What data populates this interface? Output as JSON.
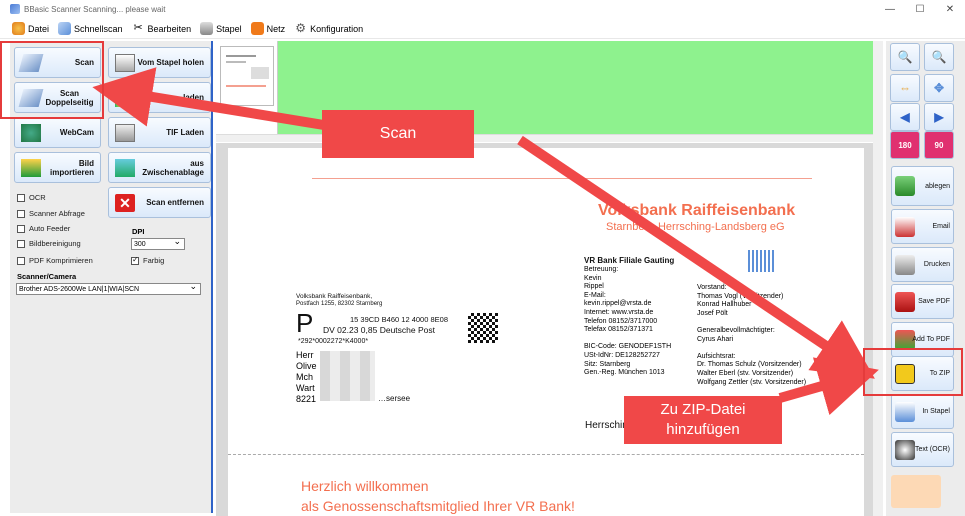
{
  "window": {
    "title": "BBasic Scanner Scanning... please wait",
    "controls": [
      "—",
      "☐",
      "✕"
    ]
  },
  "menu": [
    {
      "label": "Datei",
      "icon": "datei-icon",
      "color": "#e8a02b"
    },
    {
      "label": "Schnellscan",
      "icon": "schnellscan-icon",
      "color": "#5b8fd8"
    },
    {
      "label": "Bearbeiten",
      "icon": "scissors-icon",
      "color": "#888888"
    },
    {
      "label": "Stapel",
      "icon": "stapel-icon",
      "color": "#7a7a7a"
    },
    {
      "label": "Netz",
      "icon": "rss-icon",
      "color": "#f07a1a"
    },
    {
      "label": "Konfiguration",
      "icon": "gear-icon",
      "color": "#555555"
    }
  ],
  "left": {
    "scan": "Scan",
    "scan_duplex": "Scan Doppelseitig",
    "stapel_holen": "Vom Stapel holen",
    "hidden_btn": "…laden",
    "webcam": "WebCam",
    "tif_laden": "TIF Laden",
    "bild_importieren": "Bild importieren",
    "zwischenablage": "aus Zwischenablage",
    "scan_entfernen": "Scan entfernen",
    "options": [
      {
        "label": "OCR",
        "checked": false
      },
      {
        "label": "Scanner Abfrage",
        "checked": false
      },
      {
        "label": "Auto Feeder",
        "checked": false
      },
      {
        "label": "Bildbereinigung",
        "checked": false
      },
      {
        "label": "PDF Komprimieren",
        "checked": false
      }
    ],
    "dpi_label": "DPI",
    "dpi_value": "300",
    "farbig": {
      "label": "Farbig",
      "checked": true
    },
    "scanner_label": "Scanner/Camera",
    "scanner_value": "Brother ADS-2600We LAN|1|WIA|SCN"
  },
  "right": {
    "zoom_in": "zoom-in-icon",
    "zoom_out": "zoom-out-icon",
    "rot180": "180",
    "rot90": "90",
    "buttons": [
      "ablegen",
      "Email",
      "Drucken",
      "Save PDF",
      "Add To PDF",
      "To ZIP",
      "In Stapel",
      "Text (OCR)"
    ]
  },
  "doc": {
    "bank_name": "Volksbank Raiffeisenbank",
    "bank_sub": "Starnberg-Herrsching-Landsberg eG",
    "sender": "Volksbank Raiffeisenbank,",
    "sender_addr": "Postfach 1255, 82302 Starnberg",
    "post_code": "15 39CD B460 12 4000 8E08",
    "post_dv": "DV 02.23  0,85  Deutsche Post",
    "post_ref": "*292*0002272*K4000*",
    "recipient": [
      "Herr",
      "Olive",
      "Mch",
      "Wart",
      "8221"
    ],
    "recipient_tail": "…sersee",
    "branch_title": "VR Bank Filiale Gauting",
    "branch_lines": [
      "Betreuung:",
      "Kevin",
      "Rippel",
      "E-Mail:",
      "kevin.rippel@vrsta.de",
      "Internet: www.vrsta.de",
      "Telefon 08152/3717000",
      "Telefax 08152/371371",
      "",
      "BIC-Code: GENODEF1STH",
      "USt-IdNr: DE128252727",
      "Sitz: Starnberg",
      "Gen.-Reg. München 1013"
    ],
    "board_lines": [
      "Vorstand:",
      "Thomas Vogl (Vorsitzender)",
      "Konrad Hallhuber",
      "Josef Pölt",
      "",
      "Generalbevollmächtigter:",
      "Cyrus Ahari",
      "",
      "Aufsichtsrat:",
      "Dr. Thomas Schulz (Vorsitzender)",
      "Walter Eberl (stv. Vorsitzender)",
      "Wolfgang Zettler (stv. Vorsitzender)"
    ],
    "date": "Herrsching, 16.02.2023",
    "welcome1": "Herzlich willkommen",
    "welcome2": "als Genossenschaftsmitglied Ihrer VR Bank!"
  },
  "callouts": {
    "scan": "Scan",
    "zip": "Zu ZIP-Datei hinzufügen"
  },
  "colors": {
    "accent": "#f04848",
    "green": "#8ef28e",
    "bank": "#f36f4f"
  }
}
